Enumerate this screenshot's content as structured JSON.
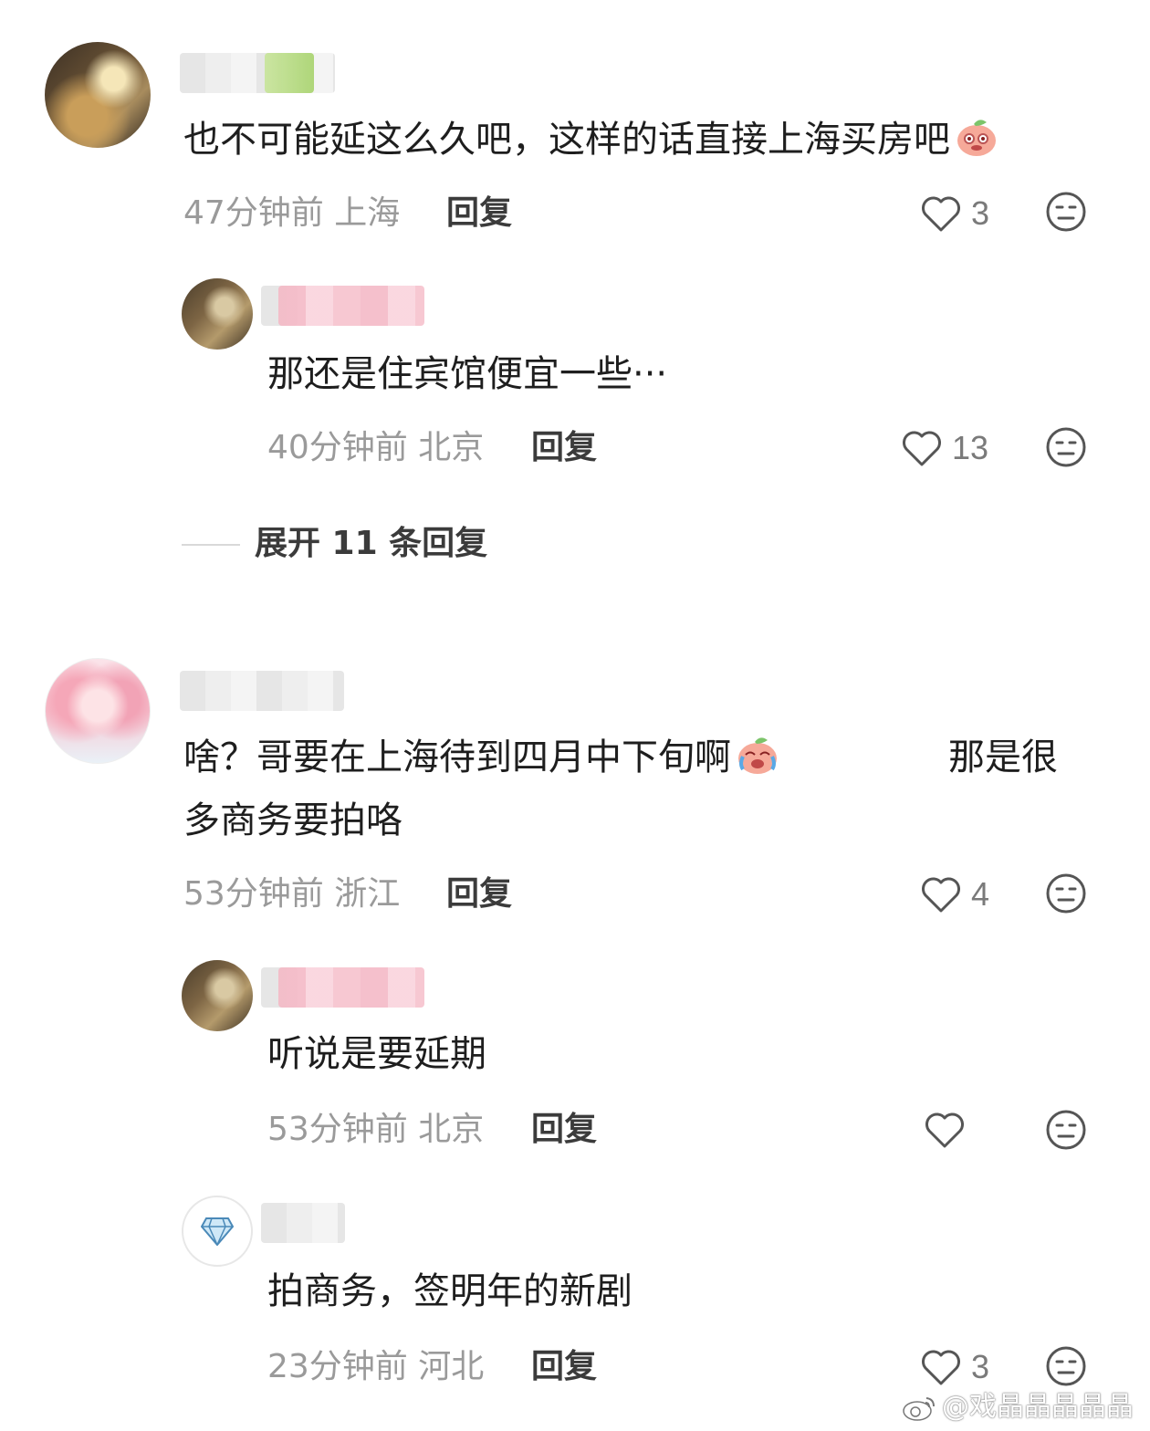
{
  "comments": [
    {
      "text": "也不可能延这么久吧，这样的话直接上海买房吧",
      "time": "47分钟前",
      "location": "上海",
      "reply_label": "回复",
      "likes": "3"
    },
    {
      "text": "那还是住宾馆便宜一些···",
      "time": "40分钟前",
      "location": "北京",
      "reply_label": "回复",
      "likes": "13"
    },
    {
      "expand_label": "展开 11 条回复"
    },
    {
      "text_line1": "啥？哥要在上海待到四月中下旬啊",
      "text_line1_tail": "那是很",
      "text_line2": "多商务要拍咯",
      "time": "53分钟前",
      "location": "浙江",
      "reply_label": "回复",
      "likes": "4"
    },
    {
      "text": "听说是要延期",
      "time": "53分钟前",
      "location": "北京",
      "reply_label": "回复",
      "likes": ""
    },
    {
      "text": "拍商务，签明年的新剧",
      "time": "23分钟前",
      "location": "河北",
      "reply_label": "回复",
      "likes": "3"
    }
  ],
  "watermark": "@戏晶晶晶晶晶",
  "icons": {
    "like": "heart-outline-icon",
    "dislike": "neutral-face-icon",
    "emoji": "peach-emoji-icon"
  }
}
